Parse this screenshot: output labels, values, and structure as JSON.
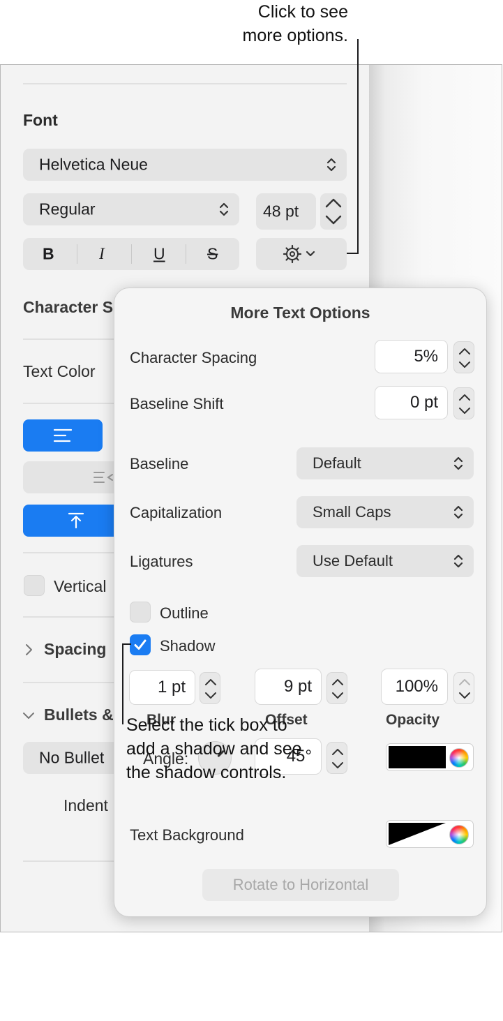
{
  "callouts": {
    "top_line1": "Click to see",
    "top_line2": "more options.",
    "bottom_line1": "Select the tick box to",
    "bottom_line2": "add a shadow and see",
    "bottom_line3": "the shadow controls."
  },
  "inspector": {
    "font_heading": "Font",
    "font_family": "Helvetica Neue",
    "typeface": "Regular",
    "font_size": "48 pt",
    "style_buttons": {
      "bold": "B",
      "italic": "I",
      "underline": "U",
      "strikethrough": "S"
    },
    "character_styles_label": "Character S",
    "text_color_label": "Text Color",
    "vertical_text_label": "Vertical",
    "spacing_label": "Spacing",
    "bullets_label": "Bullets &",
    "bullets_value": "No Bullet",
    "indent_label": "Indent"
  },
  "popover": {
    "title": "More Text Options",
    "character_spacing": {
      "label": "Character Spacing",
      "value": "5%"
    },
    "baseline_shift": {
      "label": "Baseline Shift",
      "value": "0 pt"
    },
    "baseline": {
      "label": "Baseline",
      "value": "Default"
    },
    "capitalization": {
      "label": "Capitalization",
      "value": "Small Caps"
    },
    "ligatures": {
      "label": "Ligatures",
      "value": "Use Default"
    },
    "outline": {
      "label": "Outline",
      "checked": false
    },
    "shadow": {
      "label": "Shadow",
      "checked": true,
      "blur": {
        "label": "Blur",
        "value": "1 pt"
      },
      "offset": {
        "label": "Offset",
        "value": "9 pt"
      },
      "opacity": {
        "label": "Opacity",
        "value": "100%"
      },
      "angle": {
        "label": "Angle:",
        "value": "45°",
        "degrees": 45
      },
      "color": "#000000"
    },
    "text_background": {
      "label": "Text Background"
    },
    "rotate_button": "Rotate to Horizontal"
  },
  "colors": {
    "accent": "#1a7cf2"
  }
}
